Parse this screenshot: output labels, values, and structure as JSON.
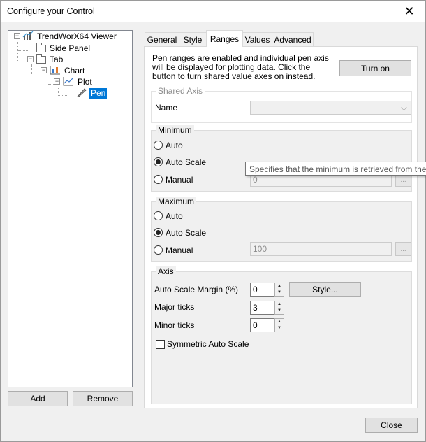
{
  "window": {
    "title": "Configure your Control",
    "close_glyph": "✕"
  },
  "tree": {
    "nodes": [
      {
        "label": "TrendWorX64 Viewer",
        "expander": "−",
        "icon": "bar-chart-icon"
      },
      {
        "label": "Side Panel",
        "icon": "folder-icon"
      },
      {
        "label": "Tab",
        "expander": "−",
        "icon": "folder-icon"
      },
      {
        "label": "Chart",
        "expander": "−",
        "icon": "chart-icon"
      },
      {
        "label": "Plot",
        "expander": "−",
        "icon": "line-chart-icon"
      },
      {
        "label": "Pen",
        "icon": "pen-icon",
        "selected": true
      }
    ]
  },
  "buttons": {
    "add": "Add",
    "remove": "Remove",
    "close": "Close",
    "turn_on": "Turn on",
    "style": "Style...",
    "ellipsis": "..."
  },
  "tabs": [
    {
      "label": "General"
    },
    {
      "label": "Style"
    },
    {
      "label": "Ranges",
      "active": true
    },
    {
      "label": "Values"
    },
    {
      "label": "Advanced"
    }
  ],
  "ranges": {
    "description": "Pen ranges are enabled and individual pen axis will be displayed for plotting data. Click the button to turn shared value axes on instead.",
    "shared_axis": {
      "title": "Shared Axis",
      "name_label": "Name",
      "name_value": ""
    },
    "minimum": {
      "title": "Minimum",
      "opt_auto": "Auto",
      "opt_auto_scale": "Auto Scale",
      "opt_manual": "Manual",
      "selected": "Auto Scale",
      "manual_value": "0"
    },
    "maximum": {
      "title": "Maximum",
      "opt_auto": "Auto",
      "opt_auto_scale": "Auto Scale",
      "opt_manual": "Manual",
      "selected": "Auto Scale",
      "manual_value": "100"
    },
    "axis": {
      "title": "Axis",
      "auto_scale_margin_label": "Auto Scale Margin (%)",
      "auto_scale_margin_value": "0",
      "major_ticks_label": "Major ticks",
      "major_ticks_value": "3",
      "minor_ticks_label": "Minor ticks",
      "minor_ticks_value": "0",
      "symmetric_label": "Symmetric Auto Scale",
      "symmetric_checked": false
    },
    "tooltip": "Specifies that the minimum is retrieved from the"
  },
  "colors": {
    "selection": "#0078d7",
    "dialog_bg": "#f0f0f0"
  }
}
